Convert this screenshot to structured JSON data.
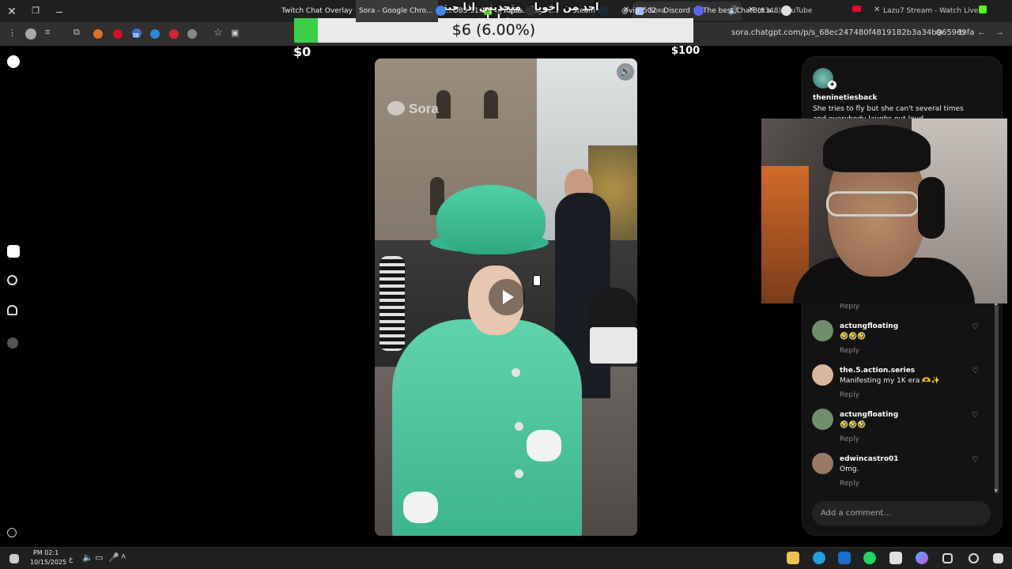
{
  "browser": {
    "tabs": [
      {
        "label": "ﺔﺟﺮﺨﻟﺍ ..ﺔﺸﻬﺘﻋ ﻉ...",
        "favicon_color": "#53fc18",
        "active": false
      },
      {
        "label": "Sora",
        "favicon_color": "#9fb8ff",
        "active": true
      },
      {
        "label": "(6348) YouTube",
        "favicon_color": "#ff0033",
        "active": false
      },
      {
        "label": "Lazu7 Stream - Watch Live on K",
        "favicon_color": "#53fc18",
        "active": false
      }
    ],
    "url": "sora.chatgpt.com/p/s_68ec247480f4819182b3a34b965969fa",
    "extension_badge": "20"
  },
  "overlay": {
    "arabic_title": "واحد من إخوياي متحديني اذا جبتها يعطيني دبلها",
    "goal_text": "$6 (6.00%)",
    "goal_progress": 0.06,
    "goal_min": "$0",
    "goal_max": "$100",
    "goal_fill_color": "#3ad04a"
  },
  "video": {
    "watermark": "Sora",
    "mute_icon": "speaker-icon",
    "play_icon": "play-icon"
  },
  "panel": {
    "author": "theninetiesback",
    "caption": "She tries to fly but she can't several times and everybody laughs out loud",
    "top_reply_label": "Reply",
    "comments": [
      {
        "user": "actungfloating",
        "text": "🤣🤣🤣",
        "reply": "Reply",
        "avatar_color": "#6f8f6a"
      },
      {
        "user": "the.5.action.series",
        "text": "Manifesting my 1K era 🫶✨",
        "reply": "Reply",
        "avatar_color": "#d8b89a"
      },
      {
        "user": "actungfloating",
        "text": "🤣🤣🤣",
        "reply": "Reply",
        "avatar_color": "#6f8f6a"
      },
      {
        "user": "edwincastro01",
        "text": "Omg.",
        "reply": "Reply",
        "avatar_color": "#9a7a66"
      }
    ],
    "comment_placeholder": "Add a comment..."
  },
  "taskbar": {
    "time": "PM 02:1",
    "date": "10/15/2025",
    "lang": "ع",
    "apps": [
      {
        "label": "Twitch Chat Overlay",
        "icon_color": "#9146ff",
        "active": false
      },
      {
        "label": "Sora - Google Chro...",
        "icon_color": "#4285f4",
        "active": true
      },
      {
        "label": "...OBS 31.1.1 - Profile",
        "icon_color": "#302e31",
        "active": false
      },
      {
        "label": "Steam",
        "icon_color": "#1b2838",
        "active": false
      },
      {
        "label": "@vip_502 - Discord",
        "icon_color": "#5865f2",
        "active": false
      },
      {
        "label": "The best ChatBot a...",
        "icon_color": "#e0e0e0",
        "active": false
      }
    ]
  }
}
